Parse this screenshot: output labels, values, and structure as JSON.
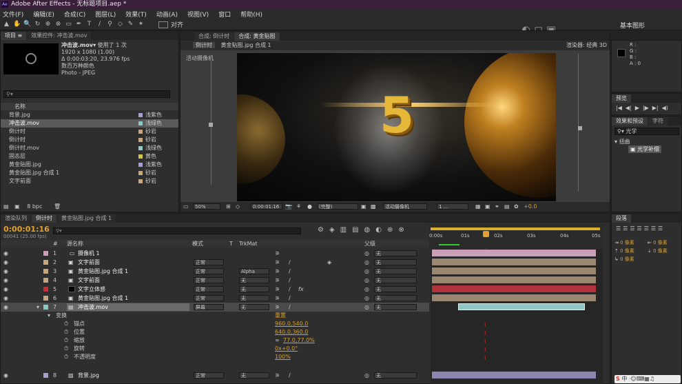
{
  "app": {
    "title": "Adobe After Effects - 无标题项目.aep *"
  },
  "menu": [
    "文件(F)",
    "编辑(E)",
    "合成(C)",
    "图层(L)",
    "效果(T)",
    "动画(A)",
    "视图(V)",
    "窗口",
    "帮助(H)"
  ],
  "toolbar": {
    "align_label": "对齐",
    "workspace": "基本图形"
  },
  "project": {
    "tabs": [
      "项目 ≡",
      "效果控件: 冲击波.mov"
    ],
    "thumb_name": "冲击波.mov▾",
    "thumb_used": "使用了 1 次",
    "info1": "1920 x 1080 (1.00)",
    "info2": "Δ 0:00:03:20, 23.976 fps",
    "info3": "数百万种颜色",
    "info4": "Photo - JPEG",
    "col_name": "名称",
    "items": [
      {
        "name": "背景.jpg",
        "label": "浅紫色",
        "color": "#a79fcf"
      },
      {
        "name": "冲击波.mov",
        "label": "浅绿色",
        "color": "#8fc7c4",
        "selected": true
      },
      {
        "name": "倒计时",
        "label": "砂岩",
        "color": "#c8a77a"
      },
      {
        "name": "倒计时",
        "label": "砂岩",
        "color": "#c8a77a"
      },
      {
        "name": "倒计时.mov",
        "label": "浅绿色",
        "color": "#8fc7c4"
      },
      {
        "name": "固态层",
        "label": "黄色",
        "color": "#d4c447"
      },
      {
        "name": "黄金贴图.jpg",
        "label": "浅紫色",
        "color": "#a79fcf"
      },
      {
        "name": "黄金贴图.jpg 合成 1",
        "label": "砂岩",
        "color": "#c8a77a"
      },
      {
        "name": "文字前面",
        "label": "砂岩",
        "color": "#c8a77a"
      }
    ],
    "bpc": "8 bpc"
  },
  "viewer": {
    "tabs": [
      "合成: 倒计时",
      "合成: 黄金贴图"
    ],
    "subtabs": [
      "倒计时",
      "黄金贴图.jpg 合成 1"
    ],
    "camera_label": "活动摄像机",
    "renderer": "渲染器: 经典 3D",
    "zoom": "50%",
    "time": "0:00:01:16",
    "quality": "(完整)",
    "camera_select": "活动摄像机",
    "views": "1 ...",
    "exposure": "+0.0",
    "countdown": "5"
  },
  "info_panel": {
    "r": "R :",
    "g": "G :",
    "b": "B :",
    "a": "A : 0"
  },
  "preview": {
    "tab": "预览",
    "controls": [
      "|◀",
      "◀|",
      "▶",
      "|▶",
      "▶|",
      "◀)"
    ]
  },
  "effects": {
    "tabs": [
      "效果和预设",
      "字符"
    ],
    "search": "光学",
    "category": "扭曲",
    "item": "光学补偿"
  },
  "paragraph": {
    "tab": "段落",
    "values": [
      "0 像素",
      "0 像素",
      "0 像素",
      "0 像素",
      "0 像素"
    ]
  },
  "timeline": {
    "tabs": [
      "渲染队列",
      "倒计时",
      "黄金贴图.jpg 合成 1"
    ],
    "timecode": "0:00:01:16",
    "frames": "00041 (25.00 fps)",
    "cols": {
      "num": "#",
      "name": "源名称",
      "mode": "模式",
      "t": "T",
      "trkmat": "TrkMat",
      "parent": "父级"
    },
    "ruler": [
      "0:00s",
      "01s",
      "02s",
      "03s",
      "04s",
      "05s"
    ],
    "layers": [
      {
        "num": "1",
        "name": "摄像机 1",
        "mode": "",
        "trk": "",
        "parent": "无",
        "color": "#c9a0b7",
        "bar": "#c9a0b7"
      },
      {
        "num": "2",
        "name": "文字前面",
        "mode": "正常",
        "trk": "",
        "parent": "无",
        "color": "#c8a77a",
        "bar": "#9b8770"
      },
      {
        "num": "3",
        "name": "黄金贴图.jpg 合成 1",
        "mode": "正常",
        "trk": "Alpha",
        "parent": "无",
        "color": "#c8a77a",
        "bar": "#9b8770"
      },
      {
        "num": "4",
        "name": "文字前面",
        "mode": "正常",
        "trk": "无",
        "parent": "无",
        "color": "#c8a77a",
        "bar": "#9b8770"
      },
      {
        "num": "5",
        "name": "文字立体感",
        "mode": "正常",
        "trk": "无",
        "parent": "无",
        "color": "#c0303a",
        "bar": "#b0333c"
      },
      {
        "num": "6",
        "name": "黄金贴图.jpg 合成 1",
        "mode": "正常",
        "trk": "无",
        "parent": "无",
        "color": "#c8a77a",
        "bar": "#9b8770"
      },
      {
        "num": "7",
        "name": "冲击波.mov",
        "mode": "屏幕",
        "trk": "无",
        "parent": "无",
        "color": "#8fc7c4",
        "bar": "#8fc7c4",
        "selected": true
      }
    ],
    "transform": {
      "label": "变换",
      "reset": "重置",
      "props": [
        {
          "name": "锚点",
          "value": "960.0,540.0"
        },
        {
          "name": "位置",
          "value": "640.0,360.0"
        },
        {
          "name": "缩放",
          "value": "77.0,77.0%"
        },
        {
          "name": "旋转",
          "value": "0x+0.0°"
        },
        {
          "name": "不透明度",
          "value": "100%"
        }
      ]
    },
    "bg_layer": {
      "num": "8",
      "name": "背景.jpg",
      "mode": "正常",
      "trk": "无",
      "parent": "无",
      "color": "#a79fcf"
    }
  },
  "tray": {
    "text": "中"
  }
}
